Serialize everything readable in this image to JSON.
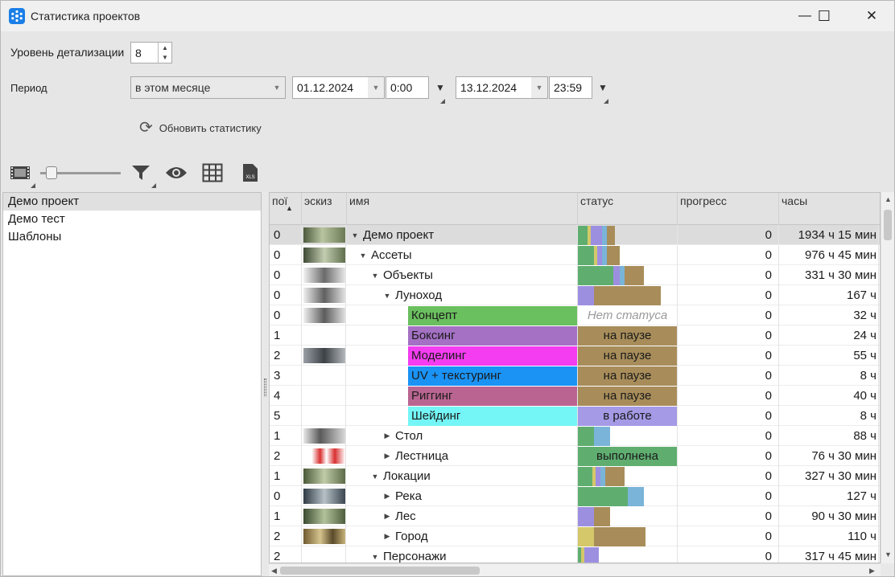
{
  "window": {
    "title": "Статистика проектов",
    "min": "—",
    "max": "☐",
    "close": "✕"
  },
  "controls": {
    "detail_label": "Уровень детализации",
    "detail_value": "8",
    "period_label": "Период",
    "period_select": "в этом месяце",
    "date_from": "01.12.2024",
    "time_from": "0:00",
    "date_to": "13.12.2024",
    "time_to": "23:59",
    "refresh": "Обновить статистику"
  },
  "toolbar": {
    "xls": "XLS"
  },
  "projects": [
    "Демо проект",
    "Демо тест",
    "Шаблоны"
  ],
  "columns": {
    "priority": "пої",
    "thumb": "эскиз",
    "name": "имя",
    "status": "статус",
    "progress": "прогресс",
    "hours": "часы"
  },
  "colors": {
    "green": "#5fae70",
    "blue": "#7ab4d8",
    "purple": "#9c8fe0",
    "brown": "#a88d5a",
    "yellow": "#d4c86a"
  },
  "rows": [
    {
      "prio": "0",
      "name": "Демо проект",
      "progress": "0",
      "hours": "1934 ч 15 мин"
    },
    {
      "prio": "0",
      "name": "Ассеты",
      "progress": "0",
      "hours": "976 ч 45 мин"
    },
    {
      "prio": "0",
      "name": "Объекты",
      "progress": "0",
      "hours": "331 ч 30 мин"
    },
    {
      "prio": "0",
      "name": "Луноход",
      "progress": "0",
      "hours": "167 ч"
    },
    {
      "prio": "0",
      "name": "Концепт",
      "status": "Нет статуса",
      "progress": "0",
      "hours": "32 ч"
    },
    {
      "prio": "1",
      "name": "Боксинг",
      "status": "на паузе",
      "progress": "0",
      "hours": "24 ч"
    },
    {
      "prio": "2",
      "name": "Моделинг",
      "status": "на паузе",
      "progress": "0",
      "hours": "55 ч"
    },
    {
      "prio": "3",
      "name": "UV + текстуринг",
      "status": "на паузе",
      "progress": "0",
      "hours": "8 ч"
    },
    {
      "prio": "4",
      "name": "Риггинг",
      "status": "на паузе",
      "progress": "0",
      "hours": "40 ч"
    },
    {
      "prio": "5",
      "name": "Шейдинг",
      "status": "в работе",
      "progress": "0",
      "hours": "8 ч"
    },
    {
      "prio": "1",
      "name": "Стол",
      "progress": "0",
      "hours": "88 ч"
    },
    {
      "prio": "2",
      "name": "Лестница",
      "status": "выполнена",
      "progress": "0",
      "hours": "76 ч 30 мин"
    },
    {
      "prio": "1",
      "name": "Локации",
      "progress": "0",
      "hours": "327 ч 30 мин"
    },
    {
      "prio": "0",
      "name": "Река",
      "progress": "0",
      "hours": "127 ч"
    },
    {
      "prio": "1",
      "name": "Лес",
      "progress": "0",
      "hours": "90 ч 30 мин"
    },
    {
      "prio": "2",
      "name": "Город",
      "progress": "0",
      "hours": "110 ч"
    },
    {
      "prio": "2",
      "name": "Персонажи",
      "progress": "0",
      "hours": "317 ч 45 мин"
    }
  ]
}
